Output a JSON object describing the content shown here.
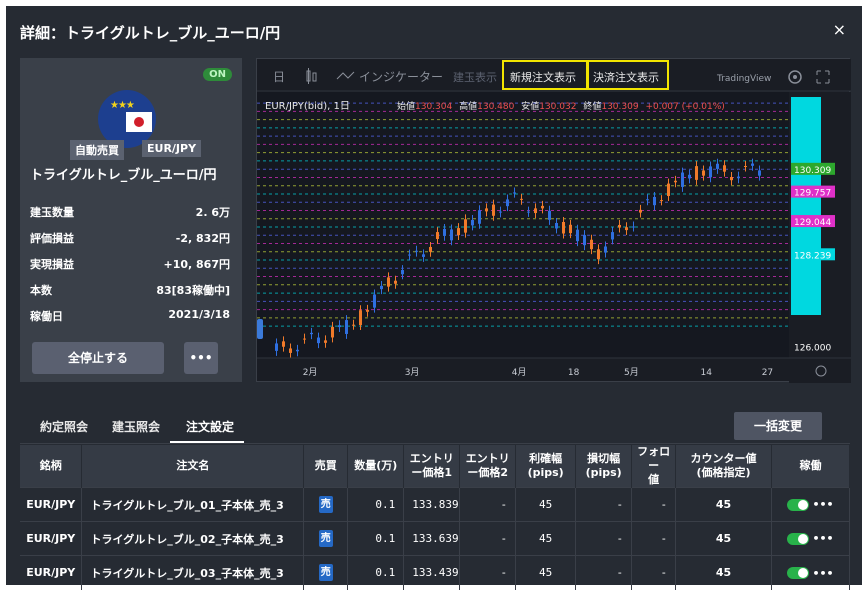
{
  "window": {
    "title": "詳細：トライグルトレ_ブル_ユーロ/円",
    "close_icon": "×"
  },
  "left_panel": {
    "status_badge": "ON",
    "tags": [
      "自動売買",
      "EUR/JPY"
    ],
    "strategy_name": "トライグルトレ_ブル_ユーロ/円",
    "stats": [
      {
        "label": "建玉数量",
        "value": "2. 6万"
      },
      {
        "label": "評価損益",
        "value": "-2, 832円"
      },
      {
        "label": "実現損益",
        "value": "+10, 867円"
      },
      {
        "label": "本数",
        "value": "83[83稼働中]"
      },
      {
        "label": "稼働日",
        "value": "2021/3/18"
      }
    ],
    "stop_all_button": "全停止する",
    "more_button": "•••"
  },
  "chart": {
    "toolbar": {
      "day_label": "日",
      "candle_icon": "candlestick-icon",
      "indicator_label": "インジケーター",
      "position_label": "建玉表示",
      "new_order_label": "新規注文表示",
      "settle_order_label": "決済注文表示",
      "brand_label": "TradingView",
      "settings_icon": "gear-icon",
      "expand_icon": "expand-icon"
    },
    "legend": {
      "symbol": "EUR/JPY(bid), 1日",
      "open_label": "始値",
      "open": "130.304",
      "high_label": "高値",
      "high": "130.480",
      "low_label": "安値",
      "low": "130.032",
      "close_label": "終値",
      "close": "130.309",
      "change": "+0.007 (+0.01%)"
    },
    "price_tags": [
      {
        "value": "130.309",
        "color": "#2da82d"
      },
      {
        "value": "129.757",
        "color": "#e030c8"
      },
      {
        "value": "129.044",
        "color": "#e030c8"
      },
      {
        "value": "128.239",
        "color": "#00d8e0"
      },
      {
        "value": "126.000",
        "color": "#1a1d24"
      }
    ],
    "x_ticks": [
      "2月",
      "3月",
      "4月",
      "18",
      "5月",
      "14",
      "27"
    ]
  },
  "chart_data": {
    "type": "line",
    "title": "",
    "xlabel": "",
    "ylabel": "",
    "x": [
      "2月",
      "3月",
      "4月",
      "18",
      "5月",
      "14",
      "27"
    ],
    "ylim": [
      125.8,
      132.0
    ],
    "series": [
      {
        "values": [
          125.9,
          126.1,
          126.3,
          126.6,
          127.4,
          128.1,
          128.6,
          128.9,
          129.3,
          129.6,
          129.2,
          128.8,
          128.3,
          128.9,
          129.5,
          130.0,
          130.3,
          130.2,
          130.3
        ]
      }
    ]
  },
  "bottom": {
    "tabs": [
      "約定照会",
      "建玉照会",
      "注文設定"
    ],
    "active_tab": "注文設定",
    "bulk_change_button": "一括変更",
    "columns": [
      "銘柄",
      "注文名",
      "売買",
      "数量(万)",
      "エントリ\nー価格1",
      "エントリ\nー価格2",
      "利確幅\n(pips)",
      "損切幅\n(pips)",
      "フォロー\n値",
      "カウンター値\n(価格指定)",
      "稼働"
    ],
    "rows": [
      {
        "symbol": "EUR/JPY",
        "name": "トライグルトレ_ブル_01_子本体_売_3",
        "side": "売",
        "qty": "0.1",
        "entry1": "133.839",
        "entry2": "-",
        "tp": "45",
        "sl": "-",
        "follow": "-",
        "counter": "45"
      },
      {
        "symbol": "EUR/JPY",
        "name": "トライグルトレ_ブル_02_子本体_売_3",
        "side": "売",
        "qty": "0.1",
        "entry1": "133.639",
        "entry2": "-",
        "tp": "45",
        "sl": "-",
        "follow": "-",
        "counter": "45"
      },
      {
        "symbol": "EUR/JPY",
        "name": "トライグルトレ_ブル_03_子本体_売_3",
        "side": "売",
        "qty": "0.1",
        "entry1": "133.439",
        "entry2": "-",
        "tp": "45",
        "sl": "-",
        "follow": "-",
        "counter": "45"
      }
    ],
    "row_more": "•••"
  }
}
